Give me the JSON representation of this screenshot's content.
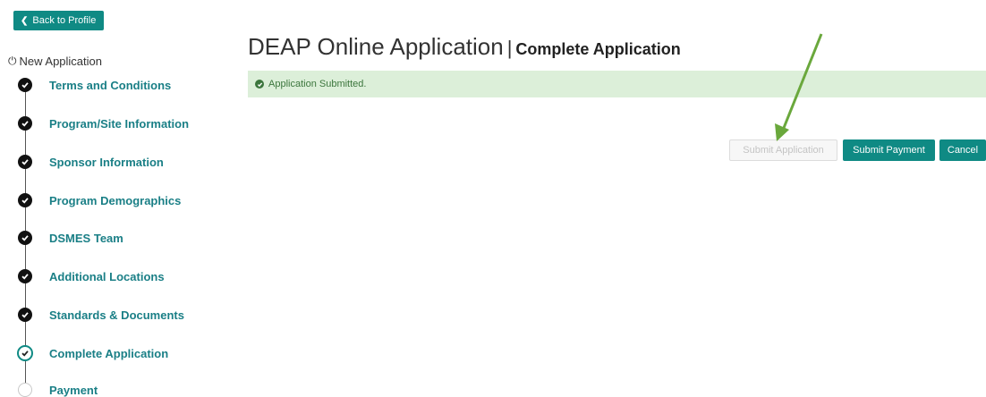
{
  "nav": {
    "back_label": "Back to Profile",
    "new_application_label": "New Application"
  },
  "steps": [
    {
      "label": "Terms and Conditions",
      "status": "done"
    },
    {
      "label": "Program/Site Information",
      "status": "done"
    },
    {
      "label": "Sponsor Information",
      "status": "done"
    },
    {
      "label": "Program Demographics",
      "status": "done"
    },
    {
      "label": "DSMES Team",
      "status": "done"
    },
    {
      "label": "Additional Locations",
      "status": "done"
    },
    {
      "label": "Standards & Documents",
      "status": "done"
    },
    {
      "label": "Complete Application",
      "status": "current"
    },
    {
      "label": "Payment",
      "status": "pending"
    }
  ],
  "header": {
    "title": "DEAP Online Application",
    "separator": "|",
    "subtitle": "Complete Application"
  },
  "alert": {
    "message": "Application Submitted."
  },
  "actions": {
    "submit_application_label": "Submit Application",
    "submit_payment_label": "Submit Payment",
    "cancel_label": "Cancel"
  },
  "colors": {
    "accent": "#0f8a84",
    "link": "#1a7f86",
    "success_bg": "#dcefd9",
    "success_text": "#3c763d",
    "annotation_arrow": "#6aa83c"
  }
}
